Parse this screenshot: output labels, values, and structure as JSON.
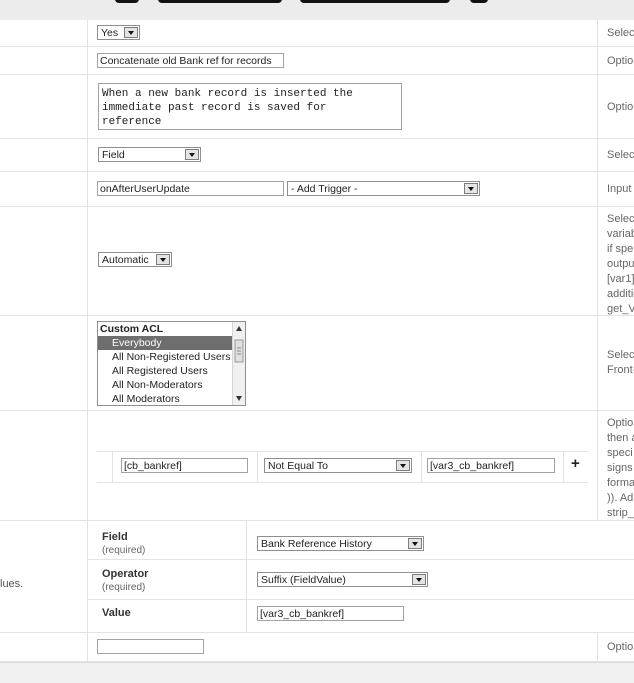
{
  "row_enabled": {
    "value": "Yes",
    "desc": "Selec"
  },
  "row_title": {
    "value": "Concatenate old Bank ref for records",
    "desc": "Optior"
  },
  "row_description": {
    "lines": [
      "When a new bank record is inserted the",
      "immediate past record is saved for",
      "reference"
    ],
    "desc": "Optior"
  },
  "row_type": {
    "value": "Field",
    "desc": "Selec"
  },
  "row_trigger": {
    "value": "onAfterUserUpdate",
    "add_trigger": "- Add Trigger -",
    "desc": "Input"
  },
  "row_user": {
    "value": "Automatic",
    "desc_lines": [
      "Selec",
      "variab",
      "if spe",
      "outpu",
      "[var1]",
      "additio",
      "get_V"
    ]
  },
  "row_access": {
    "group_label": "Custom ACL",
    "options": [
      "Everybody",
      "All Non-Registered Users",
      "All Registered Users",
      "All Non-Moderators",
      "All Moderators"
    ],
    "selected": "Everybody",
    "desc_lines": [
      "Selec",
      "Front-"
    ]
  },
  "row_conditions": {
    "field": "[cb_bankref]",
    "operator": "Not Equal To",
    "value": "[var3_cb_bankref]",
    "add_symbol": "+",
    "desc_lines": [
      "Optior",
      "then a",
      "speci",
      "signs",
      "forma",
      ")). Ad",
      "strip_"
    ]
  },
  "row_action": {
    "left_text": "lues.",
    "field_label": "Field",
    "field_req": "(required)",
    "field_value": "Bank Reference History",
    "operator_label": "Operator",
    "operator_req": "(required)",
    "operator_value": "Suffix (FieldValue)",
    "value_label": "Value",
    "value_value": "[var3_cb_bankref]"
  },
  "row_last": {
    "value": "",
    "desc": "Optior"
  },
  "colors": {
    "border": "#e3e3e3",
    "selected_option": "#6e6e6e",
    "description_text": "#666666"
  }
}
